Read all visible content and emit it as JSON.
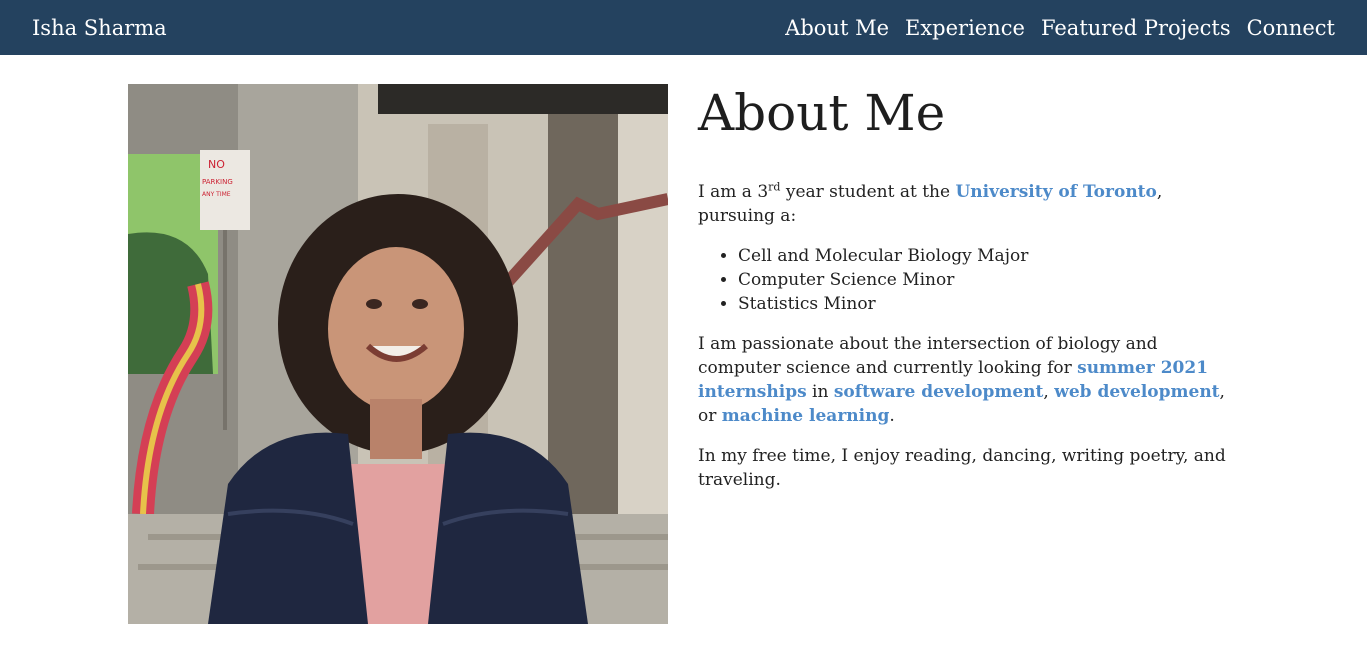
{
  "nav": {
    "brand": "Isha Sharma",
    "links": [
      "About Me",
      "Experience",
      "Featured Projects",
      "Connect"
    ]
  },
  "photo": {
    "sign_text_1": "NO",
    "sign_text_2": "PARKING",
    "sign_text_3": "ANY TIME"
  },
  "about": {
    "title": "About Me",
    "intro_pre": "I am a 3",
    "intro_sup": "rd",
    "intro_mid": " year student at the ",
    "intro_link": "University of Toronto",
    "intro_post": ", pursuing a:",
    "programs": [
      "Cell and Molecular Biology Major",
      "Computer Science Minor",
      "Statistics Minor"
    ],
    "passion_pre": "I am passionate about the intersection of biology and computer science and currently looking for ",
    "passion_link_internships": "summer 2021 internships",
    "passion_in": " in ",
    "passion_link_software": "software development",
    "passion_comma": ", ",
    "passion_link_web": "web development",
    "passion_or": ", or ",
    "passion_link_ml": "machine learning",
    "passion_end": ".",
    "free_time": "In my free time, I enjoy reading, dancing, writing poetry, and traveling."
  },
  "colors": {
    "navbar": "#24425f",
    "link": "#4d8ac9",
    "text": "#222222"
  }
}
